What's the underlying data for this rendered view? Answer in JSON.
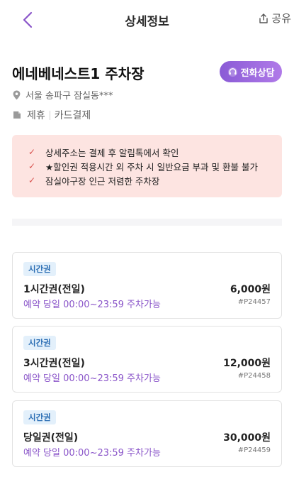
{
  "header": {
    "title": "상세정보",
    "share_label": "공유"
  },
  "lot": {
    "name": "에네베네스트1 주차장",
    "call_button": "전화상담",
    "address": "서울 송파구 잠실동***",
    "tags": [
      "제휴",
      "카드결제"
    ]
  },
  "notices": [
    "주소는 결제 후 알림톡에서 확인",
    "★할인권 적용시간 외 주차 시 일반요금 부과 및 환불 불가",
    "잠실야구장 인근 저렴한 주차장"
  ],
  "notice_prefix": "상세",
  "tickets": [
    {
      "badge": "시간권",
      "name": "1시간권(전일)",
      "price": "6,000원",
      "time": "예약 당일 00:00~23:59 주차가능",
      "code": "#P24457"
    },
    {
      "badge": "시간권",
      "name": "3시간권(전일)",
      "price": "12,000원",
      "time": "예약 당일 00:00~23:59 주차가능",
      "code": "#P24458"
    },
    {
      "badge": "시간권",
      "name": "당일권(전일)",
      "price": "30,000원",
      "time": "예약 당일 00:00~23:59 주차가능",
      "code": "#P24459"
    }
  ],
  "colors": {
    "accent": "#8a55c9",
    "notice_bg": "#fde4e1",
    "badge_bg": "#e3f0fb"
  },
  "icons": {
    "back": "chevron-left-icon",
    "share": "share-icon",
    "call": "headset-icon",
    "address": "location-pin-icon",
    "tags": "tag-icon",
    "notice": "check-icon"
  }
}
